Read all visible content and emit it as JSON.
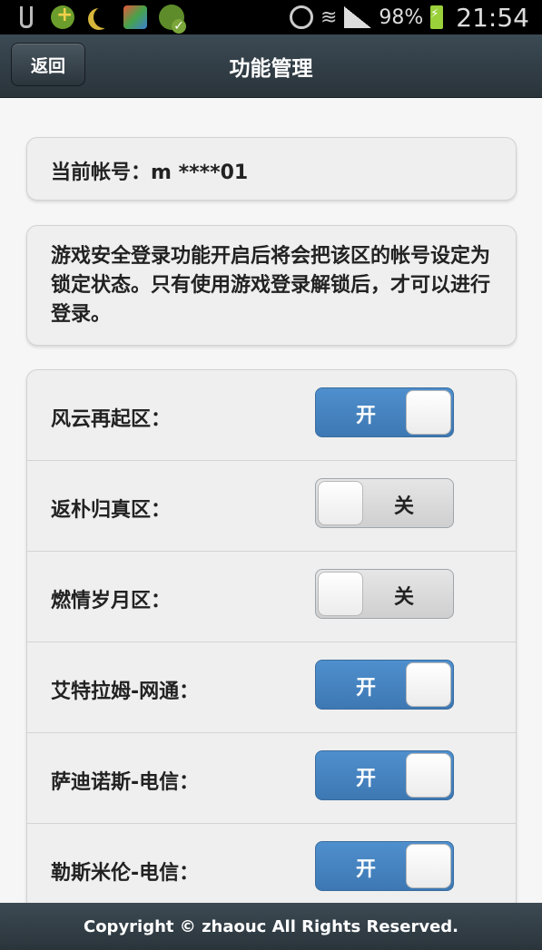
{
  "status_bar": {
    "battery": "98%",
    "time": "21:54",
    "icons": [
      "usb-icon",
      "game-center-icon",
      "moon-icon",
      "gift-app-icon",
      "badge-check-icon",
      "alarm-icon",
      "wifi-icon",
      "signal-icon",
      "battery-charging-icon"
    ]
  },
  "header": {
    "back_label": "返回",
    "title": "功能管理"
  },
  "account": {
    "label": "当前帐号：m ****01"
  },
  "info": {
    "text": "游戏安全登录功能开启后将会把该区的帐号设定为锁定状态。只有使用游戏登录解锁后，才可以进行登录。"
  },
  "zones": [
    {
      "name": "风云再起区：",
      "state": "on",
      "state_label": "开"
    },
    {
      "name": "返朴归真区：",
      "state": "off",
      "state_label": "关"
    },
    {
      "name": "燃情岁月区：",
      "state": "off",
      "state_label": "关"
    },
    {
      "name": "艾特拉姆-网通：",
      "state": "on",
      "state_label": "开"
    },
    {
      "name": "萨迪诺斯-电信：",
      "state": "on",
      "state_label": "开"
    },
    {
      "name": "勒斯米伦-电信：",
      "state": "on",
      "state_label": "开"
    }
  ],
  "footer": {
    "copyright": "Copyright © zhaouc All Rights Reserved."
  },
  "colors": {
    "header_bg": "#2f3a41",
    "toggle_on": "#4a89c8",
    "toggle_off": "#dcdcdc"
  }
}
